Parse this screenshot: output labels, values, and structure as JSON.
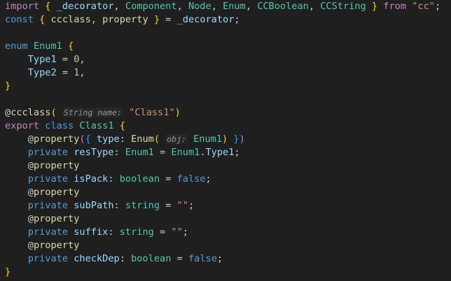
{
  "colors": {
    "background": "#1f1f1f",
    "keyword": "#569cd6",
    "control": "#c586c0",
    "type": "#4ec9b0",
    "variable": "#9cdcfe",
    "function": "#dcdcaa",
    "string": "#ce9178",
    "number": "#b5cea8",
    "plain": "#cccccc",
    "brace_gold": "#ffd700",
    "brace_purple": "#da70d6",
    "brace_blue": "#179fff",
    "inlay_hint": "#969696"
  },
  "code": {
    "lines": [
      [
        {
          "t": "import",
          "c": "control"
        },
        {
          "t": " ",
          "c": "plain"
        },
        {
          "t": "{",
          "c": "brace_gold"
        },
        {
          "t": " ",
          "c": "plain"
        },
        {
          "t": "_decorator",
          "c": "variable"
        },
        {
          "t": ", ",
          "c": "plain"
        },
        {
          "t": "Component",
          "c": "type"
        },
        {
          "t": ", ",
          "c": "plain"
        },
        {
          "t": "Node",
          "c": "type"
        },
        {
          "t": ", ",
          "c": "plain"
        },
        {
          "t": "Enum",
          "c": "type"
        },
        {
          "t": ", ",
          "c": "plain"
        },
        {
          "t": "CCBoolean",
          "c": "type"
        },
        {
          "t": ", ",
          "c": "plain"
        },
        {
          "t": "CCString",
          "c": "type"
        },
        {
          "t": " ",
          "c": "plain"
        },
        {
          "t": "}",
          "c": "brace_gold"
        },
        {
          "t": " ",
          "c": "plain"
        },
        {
          "t": "from",
          "c": "control"
        },
        {
          "t": " ",
          "c": "plain"
        },
        {
          "t": "\"cc\"",
          "c": "string"
        },
        {
          "t": ";",
          "c": "plain"
        }
      ],
      [
        {
          "t": "const",
          "c": "keyword"
        },
        {
          "t": " ",
          "c": "plain"
        },
        {
          "t": "{",
          "c": "brace_gold"
        },
        {
          "t": " ",
          "c": "plain"
        },
        {
          "t": "ccclass",
          "c": "function"
        },
        {
          "t": ", ",
          "c": "plain"
        },
        {
          "t": "property",
          "c": "function"
        },
        {
          "t": " ",
          "c": "plain"
        },
        {
          "t": "}",
          "c": "brace_gold"
        },
        {
          "t": " = ",
          "c": "plain"
        },
        {
          "t": "_decorator",
          "c": "variable"
        },
        {
          "t": ";",
          "c": "plain"
        }
      ],
      [],
      [
        {
          "t": "enum",
          "c": "keyword"
        },
        {
          "t": " ",
          "c": "plain"
        },
        {
          "t": "Enum1",
          "c": "type"
        },
        {
          "t": " ",
          "c": "plain"
        },
        {
          "t": "{",
          "c": "brace_gold"
        }
      ],
      [
        {
          "t": "    ",
          "c": "plain"
        },
        {
          "t": "Type1",
          "c": "variable"
        },
        {
          "t": " = ",
          "c": "plain"
        },
        {
          "t": "0",
          "c": "number"
        },
        {
          "t": ",",
          "c": "plain"
        }
      ],
      [
        {
          "t": "    ",
          "c": "plain"
        },
        {
          "t": "Type2",
          "c": "variable"
        },
        {
          "t": " = ",
          "c": "plain"
        },
        {
          "t": "1",
          "c": "number"
        },
        {
          "t": ",",
          "c": "plain"
        }
      ],
      [
        {
          "t": "}",
          "c": "brace_gold"
        }
      ],
      [],
      [
        {
          "t": "@",
          "c": "plain"
        },
        {
          "t": "ccclass",
          "c": "function"
        },
        {
          "t": "(",
          "c": "brace_gold"
        },
        {
          "t": " ",
          "c": "plain"
        },
        {
          "hint": "String name:"
        },
        {
          "t": " ",
          "c": "plain"
        },
        {
          "t": "\"Class1\"",
          "c": "string"
        },
        {
          "t": ")",
          "c": "brace_gold"
        }
      ],
      [
        {
          "t": "export",
          "c": "control"
        },
        {
          "t": " ",
          "c": "plain"
        },
        {
          "t": "class",
          "c": "keyword"
        },
        {
          "t": " ",
          "c": "plain"
        },
        {
          "t": "Class1",
          "c": "type"
        },
        {
          "t": " ",
          "c": "plain"
        },
        {
          "t": "{",
          "c": "brace_gold"
        }
      ],
      [
        {
          "t": "    ",
          "c": "plain"
        },
        {
          "t": "@",
          "c": "plain"
        },
        {
          "t": "property",
          "c": "function"
        },
        {
          "t": "(",
          "c": "brace_purple"
        },
        {
          "t": "{",
          "c": "brace_blue"
        },
        {
          "t": " ",
          "c": "plain"
        },
        {
          "t": "type",
          "c": "variable"
        },
        {
          "t": ": ",
          "c": "plain"
        },
        {
          "t": "Enum",
          "c": "function"
        },
        {
          "t": "(",
          "c": "brace_gold"
        },
        {
          "t": " ",
          "c": "plain"
        },
        {
          "hint": "obj:"
        },
        {
          "t": " ",
          "c": "plain"
        },
        {
          "t": "Enum1",
          "c": "type"
        },
        {
          "t": ")",
          "c": "brace_gold"
        },
        {
          "t": " ",
          "c": "plain"
        },
        {
          "t": "}",
          "c": "brace_blue"
        },
        {
          "t": ")",
          "c": "brace_purple"
        }
      ],
      [
        {
          "t": "    ",
          "c": "plain"
        },
        {
          "t": "private",
          "c": "keyword"
        },
        {
          "t": " ",
          "c": "plain"
        },
        {
          "t": "resType",
          "c": "variable"
        },
        {
          "t": ": ",
          "c": "plain"
        },
        {
          "t": "Enum1",
          "c": "type"
        },
        {
          "t": " = ",
          "c": "plain"
        },
        {
          "t": "Enum1",
          "c": "type"
        },
        {
          "t": ".",
          "c": "plain"
        },
        {
          "t": "Type1",
          "c": "variable"
        },
        {
          "t": ";",
          "c": "plain"
        }
      ],
      [
        {
          "t": "    ",
          "c": "plain"
        },
        {
          "t": "@",
          "c": "plain"
        },
        {
          "t": "property",
          "c": "function"
        }
      ],
      [
        {
          "t": "    ",
          "c": "plain"
        },
        {
          "t": "private",
          "c": "keyword"
        },
        {
          "t": " ",
          "c": "plain"
        },
        {
          "t": "isPack",
          "c": "variable"
        },
        {
          "t": ": ",
          "c": "plain"
        },
        {
          "t": "boolean",
          "c": "type"
        },
        {
          "t": " = ",
          "c": "plain"
        },
        {
          "t": "false",
          "c": "keyword"
        },
        {
          "t": ";",
          "c": "plain"
        }
      ],
      [
        {
          "t": "    ",
          "c": "plain"
        },
        {
          "t": "@",
          "c": "plain"
        },
        {
          "t": "property",
          "c": "function"
        }
      ],
      [
        {
          "t": "    ",
          "c": "plain"
        },
        {
          "t": "private",
          "c": "keyword"
        },
        {
          "t": " ",
          "c": "plain"
        },
        {
          "t": "subPath",
          "c": "variable"
        },
        {
          "t": ": ",
          "c": "plain"
        },
        {
          "t": "string",
          "c": "type"
        },
        {
          "t": " = ",
          "c": "plain"
        },
        {
          "t": "\"\"",
          "c": "string"
        },
        {
          "t": ";",
          "c": "plain"
        }
      ],
      [
        {
          "t": "    ",
          "c": "plain"
        },
        {
          "t": "@",
          "c": "plain"
        },
        {
          "t": "property",
          "c": "function"
        }
      ],
      [
        {
          "t": "    ",
          "c": "plain"
        },
        {
          "t": "private",
          "c": "keyword"
        },
        {
          "t": " ",
          "c": "plain"
        },
        {
          "t": "suffix",
          "c": "variable"
        },
        {
          "t": ": ",
          "c": "plain"
        },
        {
          "t": "string",
          "c": "type"
        },
        {
          "t": " = ",
          "c": "plain"
        },
        {
          "t": "\"\"",
          "c": "string"
        },
        {
          "t": ";",
          "c": "plain"
        }
      ],
      [
        {
          "t": "    ",
          "c": "plain"
        },
        {
          "t": "@",
          "c": "plain"
        },
        {
          "t": "property",
          "c": "function"
        }
      ],
      [
        {
          "t": "    ",
          "c": "plain"
        },
        {
          "t": "private",
          "c": "keyword"
        },
        {
          "t": " ",
          "c": "plain"
        },
        {
          "t": "checkDep",
          "c": "variable"
        },
        {
          "t": ": ",
          "c": "plain"
        },
        {
          "t": "boolean",
          "c": "type"
        },
        {
          "t": " = ",
          "c": "plain"
        },
        {
          "t": "false",
          "c": "keyword"
        },
        {
          "t": ";",
          "c": "plain"
        }
      ],
      [
        {
          "t": "}",
          "c": "brace_gold"
        }
      ]
    ]
  }
}
